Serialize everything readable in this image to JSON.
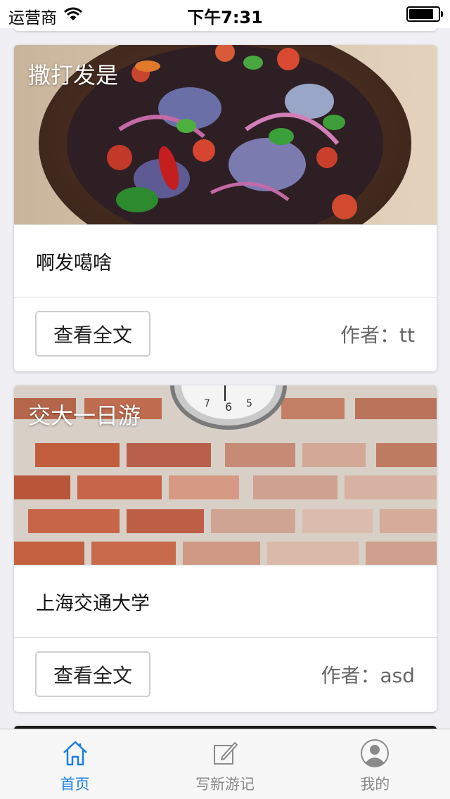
{
  "status_bar": {
    "carrier": "运营商",
    "time": "下午7:31"
  },
  "cards": [
    {
      "overlay_title": "撒打发是",
      "body_text": "啊发噶啥",
      "read_button_label": "查看全文",
      "author": "作者：tt"
    },
    {
      "overlay_title": "交大一日游",
      "body_text": "上海交通大学",
      "read_button_label": "查看全文",
      "author": "作者：asd"
    }
  ],
  "tab_bar": {
    "tabs": [
      {
        "label": "首页",
        "icon": "home-icon",
        "active": true
      },
      {
        "label": "写新游记",
        "icon": "compose-icon",
        "active": false
      },
      {
        "label": "我的",
        "icon": "profile-icon",
        "active": false
      }
    ]
  },
  "colors": {
    "accent": "#1a7fe0",
    "background": "#efeff4",
    "inactive_tab": "#8a8a8a"
  }
}
